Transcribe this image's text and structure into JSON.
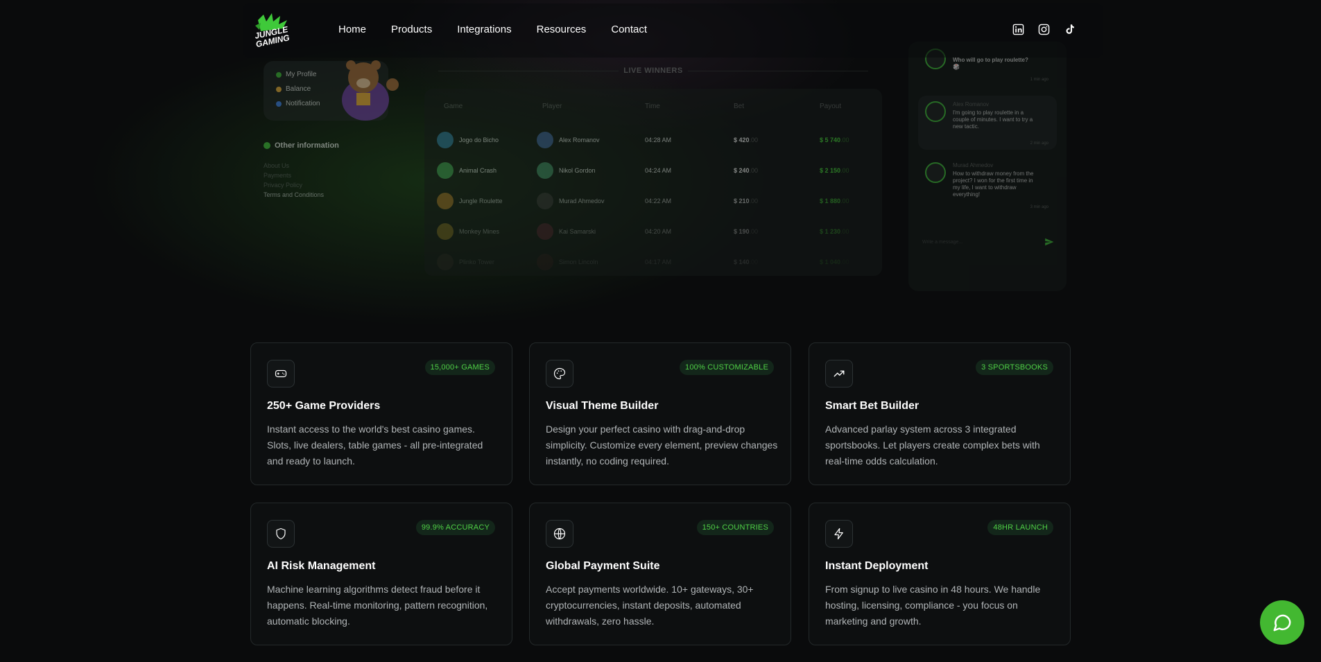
{
  "header": {
    "logo_text": [
      "JUNGLE",
      "GAMING"
    ],
    "nav": [
      "Home",
      "Products",
      "Integrations",
      "Resources",
      "Contact"
    ],
    "socials": [
      "linkedin-icon",
      "instagram-icon",
      "tiktok-icon"
    ]
  },
  "preview": {
    "profile_menu": [
      "My Profile",
      "Balance",
      "Notification"
    ],
    "other_info_title": "Other information",
    "other_links": [
      "About Us",
      "Payments",
      "Privacy Policy",
      "Terms and Conditions"
    ],
    "live_winners_title": "LIVE WINNERS",
    "columns": [
      "Game",
      "Player",
      "Time",
      "Bet",
      "Payout"
    ],
    "rows": [
      {
        "game": "Jogo do Bicho",
        "player": "Alex Romanov",
        "time": "04:28 AM",
        "bet": "$ 420",
        "bet_dec": ".00",
        "payout": "$ 5 740",
        "payout_dec": ".00"
      },
      {
        "game": "Animal Crash",
        "player": "Nikol Gordon",
        "time": "04:24 AM",
        "bet": "$ 240",
        "bet_dec": ".00",
        "payout": "$ 2 150",
        "payout_dec": ".00"
      },
      {
        "game": "Jungle Roulette",
        "player": "Murad Ahmedov",
        "time": "04:22 AM",
        "bet": "$ 210",
        "bet_dec": ".00",
        "payout": "$ 1 880",
        "payout_dec": ".00"
      },
      {
        "game": "Monkey Mines",
        "player": "Kai Samarski",
        "time": "04:20 AM",
        "bet": "$ 190",
        "bet_dec": ".00",
        "payout": "$ 1 230",
        "payout_dec": ".00"
      },
      {
        "game": "Plinko Tower",
        "player": "Simon Lincoln",
        "time": "04:17 AM",
        "bet": "$ 140",
        "bet_dec": ".00",
        "payout": "$ 1 040",
        "payout_dec": ".00"
      }
    ],
    "chat": [
      {
        "text": "Who will go to play roulette? 🎲",
        "time": "1 min ago"
      },
      {
        "name": "Alex Romanov",
        "text": "I'm going to play roulette in a couple of minutes. I want to try a new tactic.",
        "time": "2 min ago"
      },
      {
        "name": "Murad Ahmedov",
        "text": "How to withdraw money from the project? I won for the first time in my life, I want to withdraw everything!",
        "time": "3 min ago"
      }
    ],
    "chat_placeholder": "Write a message..."
  },
  "cards": [
    {
      "icon": "gamepad-icon",
      "badge": "15,000+ GAMES",
      "title": "250+ Game Providers",
      "desc": "Instant access to the world's best casino games. Slots, live dealers, table games - all pre-integrated and ready to launch."
    },
    {
      "icon": "palette-icon",
      "badge": "100% CUSTOMIZABLE",
      "title": "Visual Theme Builder",
      "desc": "Design your perfect casino with drag-and-drop simplicity. Customize every element, preview changes instantly, no coding required."
    },
    {
      "icon": "trending-up-icon",
      "badge": "3 SPORTSBOOKS",
      "title": "Smart Bet Builder",
      "desc": "Advanced parlay system across 3 integrated sportsbooks. Let players create complex bets with real-time odds calculation."
    },
    {
      "icon": "shield-icon",
      "badge": "99.9% ACCURACY",
      "title": "AI Risk Management",
      "desc": "Machine learning algorithms detect fraud before it happens. Real-time monitoring, pattern recognition, automatic blocking."
    },
    {
      "icon": "globe-icon",
      "badge": "150+ COUNTRIES",
      "title": "Global Payment Suite",
      "desc": "Accept payments worldwide. 10+ gateways, 30+ cryptocurrencies, instant deposits, automated withdrawals, zero hassle."
    },
    {
      "icon": "zap-icon",
      "badge": "48HR LAUNCH",
      "title": "Instant Deployment",
      "desc": "From signup to live casino in 48 hours. We handle hosting, licensing, compliance - you focus on marketing and growth."
    }
  ],
  "colors": {
    "accent": "#43b831",
    "badge_text": "#4fd046",
    "background": "#0a0b0c"
  }
}
